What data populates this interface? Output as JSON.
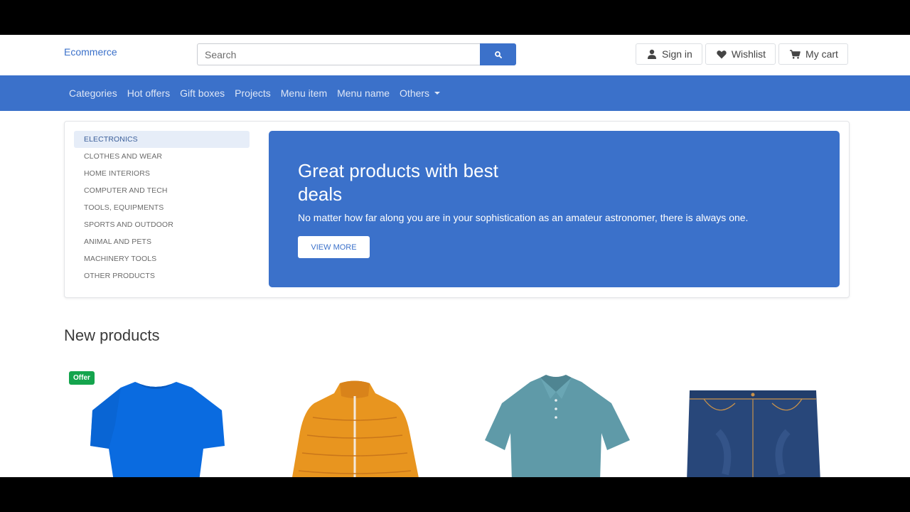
{
  "header": {
    "brand": "Ecommerce",
    "search_placeholder": "Search",
    "buttons": {
      "signin": "Sign in",
      "wishlist": "Wishlist",
      "cart": "My cart"
    }
  },
  "nav": {
    "items": [
      "Categories",
      "Hot offers",
      "Gift boxes",
      "Projects",
      "Menu item",
      "Menu name",
      "Others"
    ]
  },
  "categories": [
    "ELECTRONICS",
    "CLOTHES AND WEAR",
    "HOME INTERIORS",
    "COMPUTER AND TECH",
    "TOOLS, EQUIPMENTS",
    "SPORTS AND OUTDOOR",
    "ANIMAL AND PETS",
    "MACHINERY TOOLS",
    "OTHER PRODUCTS"
  ],
  "banner": {
    "title": "Great products with best deals",
    "text": "No matter how far along you are in your sophistication as an amateur astronomer, there is always one.",
    "button": "VIEW MORE"
  },
  "new_products": {
    "title": "New products",
    "items": [
      {
        "image": "blue-tshirt",
        "badge": "Offer"
      },
      {
        "image": "orange-puffer-jacket"
      },
      {
        "image": "teal-polo-shirt"
      },
      {
        "image": "denim-shorts"
      }
    ]
  },
  "colors": {
    "primary": "#3b71ca",
    "success": "#14a44d",
    "active_category_bg": "#e6edf8"
  }
}
